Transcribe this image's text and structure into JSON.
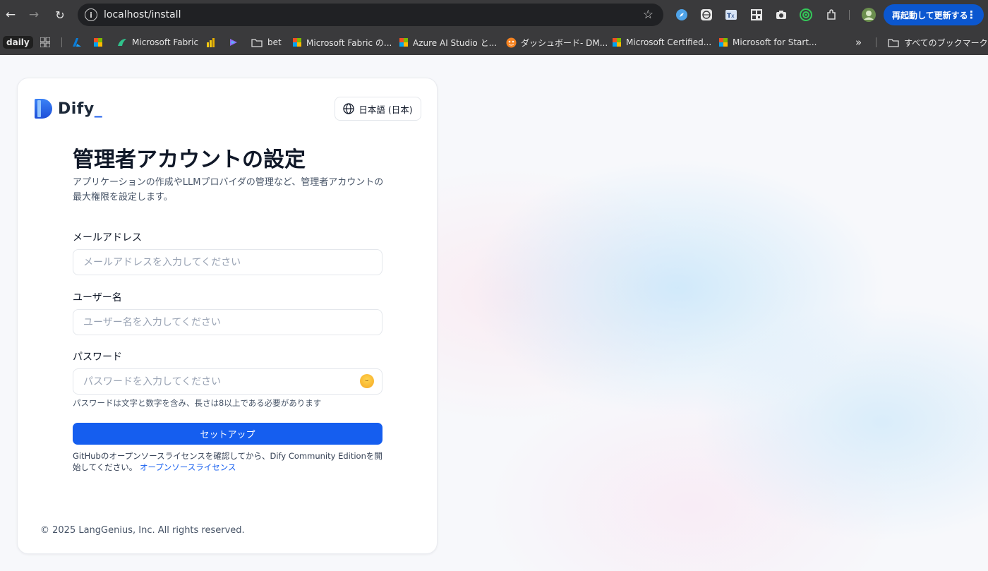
{
  "browser": {
    "url": "localhost/install",
    "update_button": "再起動して更新する",
    "update_menu_icon": "⋮",
    "bookmarks": [
      {
        "label": "daily"
      },
      {
        "label": "Microsoft Fabric"
      },
      {
        "label": "bet"
      },
      {
        "label": "Microsoft Fabric の..."
      },
      {
        "label": "Azure AI Studio と..."
      },
      {
        "label": "ダッシュボード- DM..."
      },
      {
        "label": "Microsoft Certified..."
      },
      {
        "label": "Microsoft for Start..."
      }
    ],
    "more_bookmarks": "»",
    "all_bookmarks": "すべてのブックマーク"
  },
  "card": {
    "logo_text": "Dify",
    "language_button": "日本語 (日本)",
    "title": "管理者アカウントの設定",
    "subtitle": "アプリケーションの作成やLLMプロバイダの管理など、管理者アカウントの最大権限を設定します。",
    "email": {
      "label": "メールアドレス",
      "placeholder": "メールアドレスを入力してください",
      "value": ""
    },
    "username": {
      "label": "ユーザー名",
      "placeholder": "ユーザー名を入力してください",
      "value": ""
    },
    "password": {
      "label": "パスワード",
      "placeholder": "パスワードを入力してください",
      "value": "",
      "hint": "パスワードは文字と数字を含み、長さは8以上である必要があります"
    },
    "submit": "セットアップ",
    "license_text": "GitHubのオープンソースライセンスを確認してから、Dify Community Editionを開始してください。",
    "license_link": "オープンソースライセンス",
    "footer": "© 2025 LangGenius, Inc. All rights reserved."
  },
  "colors": {
    "primary": "#155eef",
    "chrome": "#3a3a3c",
    "update_button": "#0b57d0"
  }
}
